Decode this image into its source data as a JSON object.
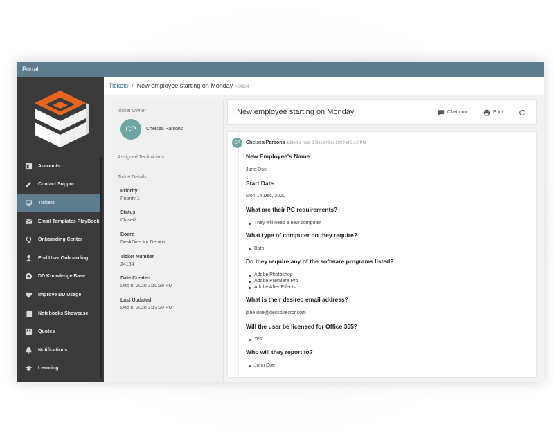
{
  "app": {
    "title": "Portal"
  },
  "sidebar": {
    "items": [
      {
        "label": "Accounts",
        "icon": "accounts-icon"
      },
      {
        "label": "Contact Support",
        "icon": "pencil-icon"
      },
      {
        "label": "Tickets",
        "icon": "monitor-icon",
        "active": true
      },
      {
        "label": "Email Templates PlayBook",
        "icon": "mail-icon"
      },
      {
        "label": "Onboarding Center",
        "icon": "lightbulb-icon"
      },
      {
        "label": "End User Onboarding",
        "icon": "person-icon"
      },
      {
        "label": "DD Knowledge Base",
        "icon": "star-icon"
      },
      {
        "label": "Improve DD Usage",
        "icon": "heart-icon"
      },
      {
        "label": "Notebooks Showcase",
        "icon": "notebook-icon"
      },
      {
        "label": "Quotes",
        "icon": "quote-icon"
      },
      {
        "label": "Notifications",
        "icon": "bell-icon"
      },
      {
        "label": "Learning",
        "icon": "graduation-cap-icon"
      }
    ]
  },
  "breadcrumb": {
    "root": "Tickets",
    "separator": "/",
    "current": "New employee starting on Monday",
    "number": "#24164"
  },
  "ticket_info": {
    "owner_heading": "Ticket Owner",
    "owner_initials": "CP",
    "owner_name": "Chelsea Parsons",
    "technicians_heading": "Assigned Technicians",
    "details_heading": "Ticket Details",
    "details": [
      {
        "label": "Priority",
        "value": "Priority 1"
      },
      {
        "label": "Status",
        "value": "Closed"
      },
      {
        "label": "Board",
        "value": "DeskDirector Demos"
      },
      {
        "label": "Ticket Number",
        "value": "24164"
      },
      {
        "label": "Date Created",
        "value": "Dec 8, 2020 3:10:38 PM"
      },
      {
        "label": "Last Updated",
        "value": "Dec 8, 2020 3:13:20 PM"
      }
    ]
  },
  "ticket": {
    "title": "New employee starting on Monday",
    "chat_label": "Chat now",
    "print_label": "Print"
  },
  "note": {
    "author_initials": "CP",
    "author": "Chelsea Parsons",
    "meta": "added a note 8 December 2020 at 3:10 PM",
    "q1": "New Employee's Name",
    "a1": "Jane Doe",
    "q2": "Start Date",
    "a2": "Mon 14 Dec, 2020",
    "q3": "What are their PC requirements?",
    "a3": "They will need a new computer",
    "q4": "What type of computer do they require?",
    "a4": "Both",
    "q5": "Do they require any of the software programs listed?",
    "a5": [
      "Adobe Photoshop",
      "Adobe Premiere Pro",
      "Adobe After Effects"
    ],
    "q6": "What is their desired email address?",
    "a6": "jane.doe@deskdirector.com",
    "q7": "Will the user be licensed for Office 365?",
    "a7": "Yes",
    "q8": "Who will they report to?",
    "a8": "John Doe"
  },
  "colors": {
    "topbar": "#5d7d8e",
    "sidebar": "#3a3a3a",
    "active_item": "#5d7d8e",
    "logo_orange": "#e8651f",
    "avatar": "#6fa6a3",
    "link": "#3d6f8f"
  }
}
